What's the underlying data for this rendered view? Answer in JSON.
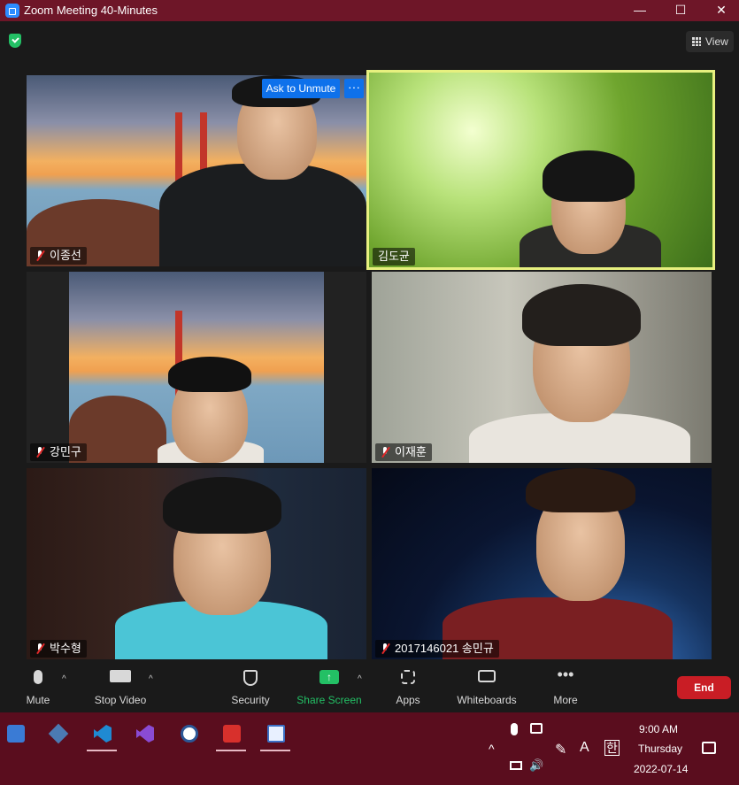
{
  "window": {
    "title": "Zoom Meeting 40-Minutes",
    "minimize": "—",
    "maximize": "☐",
    "close": "✕"
  },
  "header": {
    "view_label": "View"
  },
  "participants": [
    {
      "name": "이종선",
      "ask_unmute": "Ask to Unmute",
      "more": "···"
    },
    {
      "name": "김도균"
    },
    {
      "name": "강민구"
    },
    {
      "name": "이재훈"
    },
    {
      "name": "박수형"
    },
    {
      "name": "2017146021 송민규"
    }
  ],
  "toolbar": {
    "mute": "Mute",
    "stop_video": "Stop Video",
    "security": "Security",
    "share_screen": "Share Screen",
    "apps": "Apps",
    "whiteboards": "Whiteboards",
    "more": "More",
    "end": "End",
    "caret": "^",
    "share_color": "#23c065",
    "end_color": "#c91d25"
  },
  "taskbar": {
    "time": "9:00 AM",
    "day": "Thursday",
    "date": "2022-07-14",
    "ime_a": "A",
    "ime_han": "한",
    "tray_up": "^"
  }
}
